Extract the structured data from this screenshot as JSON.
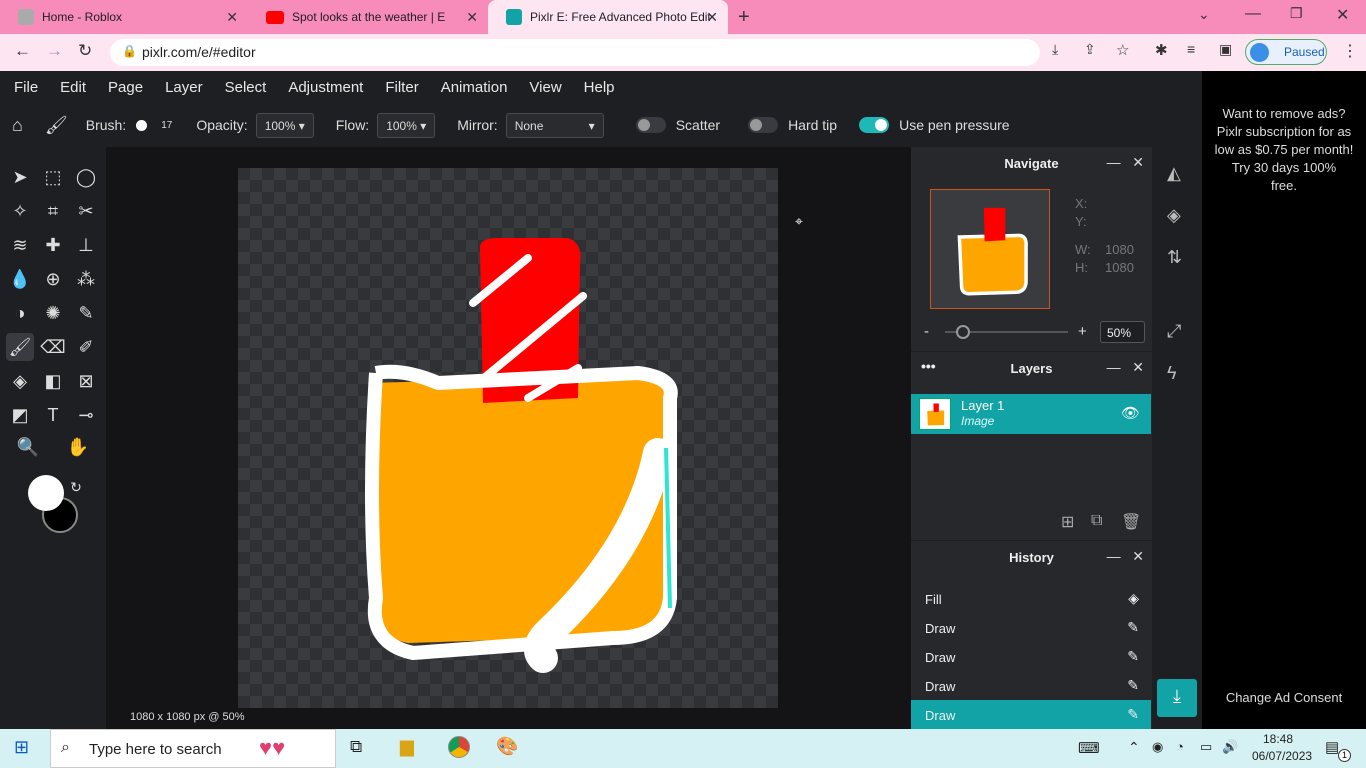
{
  "browser": {
    "tabs": [
      {
        "title": "Home - Roblox"
      },
      {
        "title": "Spot looks at the weather | E"
      },
      {
        "title": "Pixlr E: Free Advanced Photo Edit"
      }
    ],
    "url": "pixlr.com/e/#editor",
    "profile_label": "Paused"
  },
  "menu": [
    "File",
    "Edit",
    "Page",
    "Layer",
    "Select",
    "Adjustment",
    "Filter",
    "Animation",
    "View",
    "Help"
  ],
  "tool_options": {
    "brush_label": "Brush:",
    "brush_size": "17",
    "opacity_label": "Opacity:",
    "opacity_value": "100%",
    "flow_label": "Flow:",
    "flow_value": "100%",
    "mirror_label": "Mirror:",
    "mirror_value": "None",
    "scatter_label": "Scatter",
    "hardtip_label": "Hard tip",
    "pen_label": "Use pen pressure"
  },
  "canvas_info": "1080 x 1080 px @ 50%",
  "navigate": {
    "title": "Navigate",
    "x_label": "X:",
    "y_label": "Y:",
    "w_label": "W:",
    "w_value": "1080",
    "h_label": "H:",
    "h_value": "1080",
    "zoom": "50%",
    "zoom_level": 0.15
  },
  "layers": {
    "title": "Layers",
    "items": [
      {
        "name": "Layer 1",
        "type": "Image"
      }
    ]
  },
  "history": {
    "title": "History",
    "items": [
      "Fill",
      "Draw",
      "Draw",
      "Draw",
      "Draw"
    ]
  },
  "ad": {
    "text": "Want to remove ads? Pixlr subscription for as low as $0.75 per month!",
    "trial": "Try 30 days 100% free.",
    "consent": "Change Ad Consent"
  },
  "taskbar": {
    "search_placeholder": "Type here to search",
    "time": "18:48",
    "date": "06/07/2023",
    "notif_count": "1"
  },
  "colors": {
    "accent": "#11a3a6",
    "tabbar": "#f78bba"
  }
}
